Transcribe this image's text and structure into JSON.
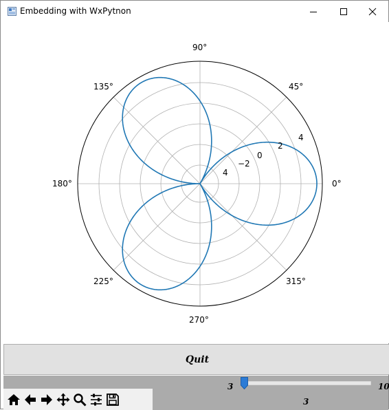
{
  "window": {
    "title": "Embedding with WxPytnon"
  },
  "polar": {
    "angle_labels": [
      "0°",
      "45°",
      "90°",
      "135°",
      "180°",
      "225°",
      "270°",
      "315°"
    ],
    "radial_tick_labels": [
      "4",
      "−2",
      "0",
      "2",
      "4"
    ],
    "curve_color": "#1f77b4"
  },
  "quit_button": {
    "label": "Quit"
  },
  "slider": {
    "min_label": "3",
    "max_label": "10",
    "value_label": "3",
    "value": 3,
    "min": 3,
    "max": 10
  },
  "toolbar": {
    "tools": [
      "home-icon",
      "back-icon",
      "forward-icon",
      "pan-icon",
      "zoom-icon",
      "configure-icon",
      "save-icon"
    ]
  },
  "colors": {
    "slider_thumb": "#2b7bd6",
    "toolbar_bg": "#f0f0f0",
    "bottom_bg": "#ababab"
  }
}
